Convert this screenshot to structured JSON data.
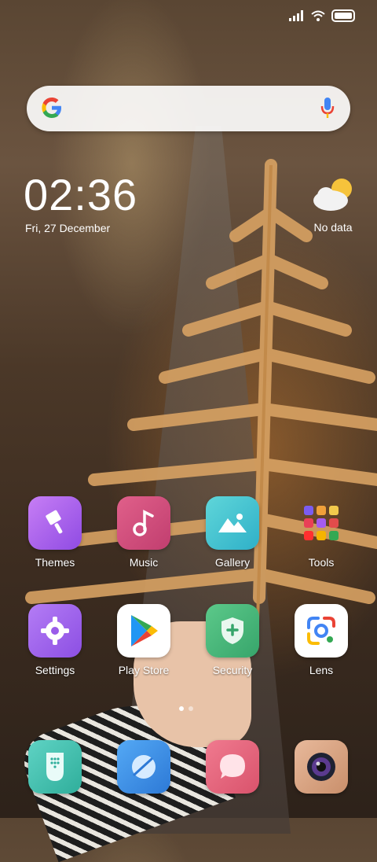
{
  "status_bar": {
    "icons": [
      "signal-icon",
      "wifi-icon",
      "battery-icon"
    ]
  },
  "search": {
    "logo": "google-logo",
    "mic_icon": "mic-icon"
  },
  "clock": {
    "time": "02:36",
    "date": "Fri, 27 December"
  },
  "weather": {
    "icon": "partly-cloudy-icon",
    "text": "No data"
  },
  "apps": [
    {
      "label": "Themes",
      "icon": "paintbrush-icon"
    },
    {
      "label": "Music",
      "icon": "music-note-icon"
    },
    {
      "label": "Gallery",
      "icon": "mountain-photo-icon"
    },
    {
      "label": "Tools",
      "icon": "folder-icon"
    },
    {
      "label": "Settings",
      "icon": "gear-icon"
    },
    {
      "label": "Play Store",
      "icon": "play-store-icon"
    },
    {
      "label": "Security",
      "icon": "shield-icon"
    },
    {
      "label": "Lens",
      "icon": "lens-icon"
    }
  ],
  "page_indicator": {
    "pages": 2,
    "current": 1
  },
  "dock": [
    {
      "icon": "phone-icon"
    },
    {
      "icon": "browser-icon"
    },
    {
      "icon": "messages-icon"
    },
    {
      "icon": "camera-icon"
    }
  ]
}
